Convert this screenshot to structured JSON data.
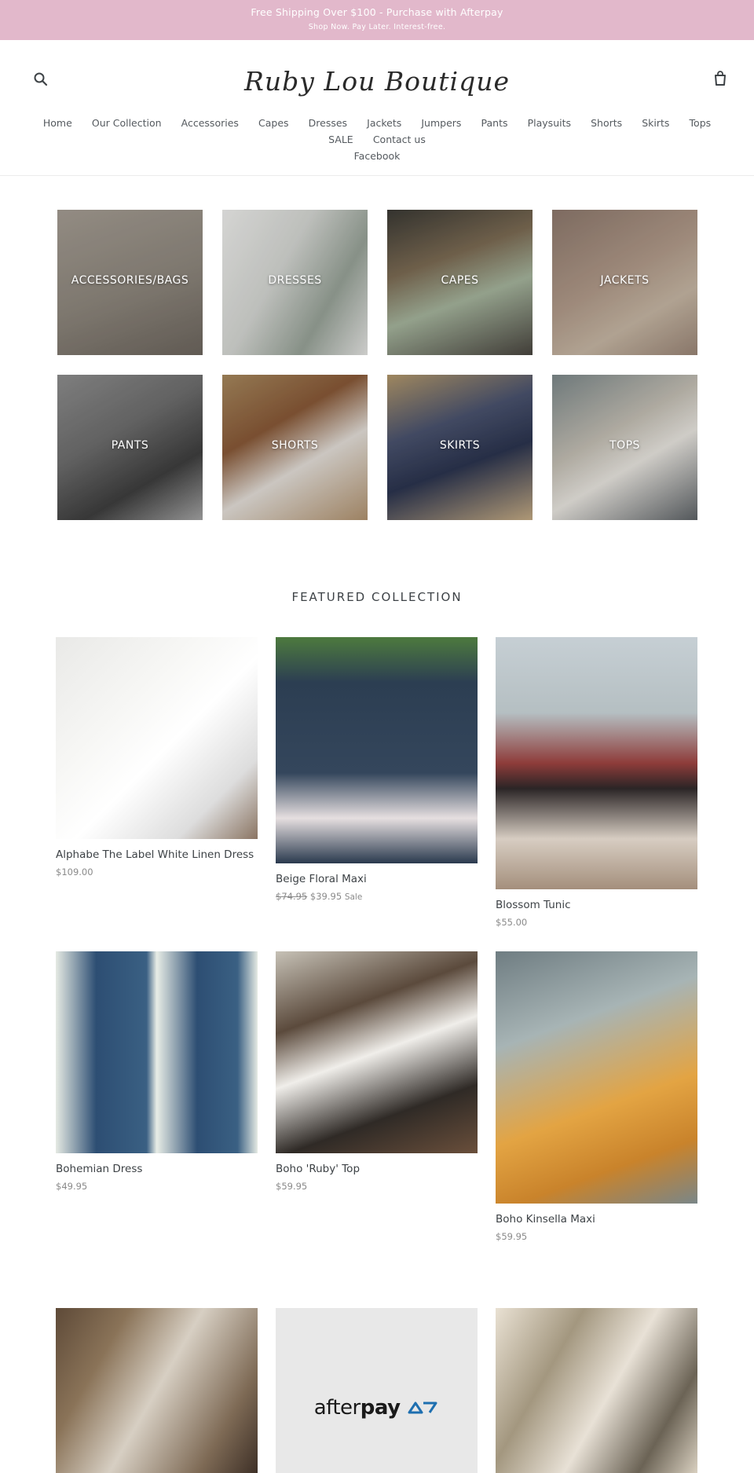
{
  "announcement": {
    "main": "Free Shipping Over $100 - Purchase with Afterpay",
    "sub": "Shop Now. Pay Later. Interest-free."
  },
  "header": {
    "logo": "Ruby Lou Boutique",
    "search_icon": "search-icon",
    "cart_icon": "cart-icon"
  },
  "nav": [
    "Home",
    "Our Collection",
    "Accessories",
    "Capes",
    "Dresses",
    "Jackets",
    "Jumpers",
    "Pants",
    "Playsuits",
    "Shorts",
    "Skirts",
    "Tops",
    "SALE",
    "Contact us",
    "Facebook"
  ],
  "collections": [
    "ACCESSORIES/BAGS",
    "DRESSES",
    "CAPES",
    "JACKETS",
    "PANTS",
    "SHORTS",
    "SKIRTS",
    "TOPS"
  ],
  "featured": {
    "title": "FEATURED COLLECTION",
    "products": [
      {
        "name": "Alphabe The Label White Linen Dress",
        "price": "$109.00"
      },
      {
        "name": "Beige Floral Maxi",
        "was": "$74.95",
        "price": "$39.95",
        "sale": "Sale"
      },
      {
        "name": "Blossom Tunic",
        "price": "$55.00"
      },
      {
        "name": "Bohemian Dress",
        "price": "$49.95"
      },
      {
        "name": "Boho 'Ruby' Top",
        "price": "$59.95"
      },
      {
        "name": "Boho Kinsella Maxi",
        "price": "$59.95"
      }
    ]
  },
  "promo": {
    "afterpay_prefix": "after",
    "afterpay_bold": "pay"
  },
  "colors": {
    "announcement_bg": "#e2b8cb",
    "text": "#3d4246",
    "muted": "#8a8a8a",
    "afterpay_mark": "#1e6fb0"
  }
}
